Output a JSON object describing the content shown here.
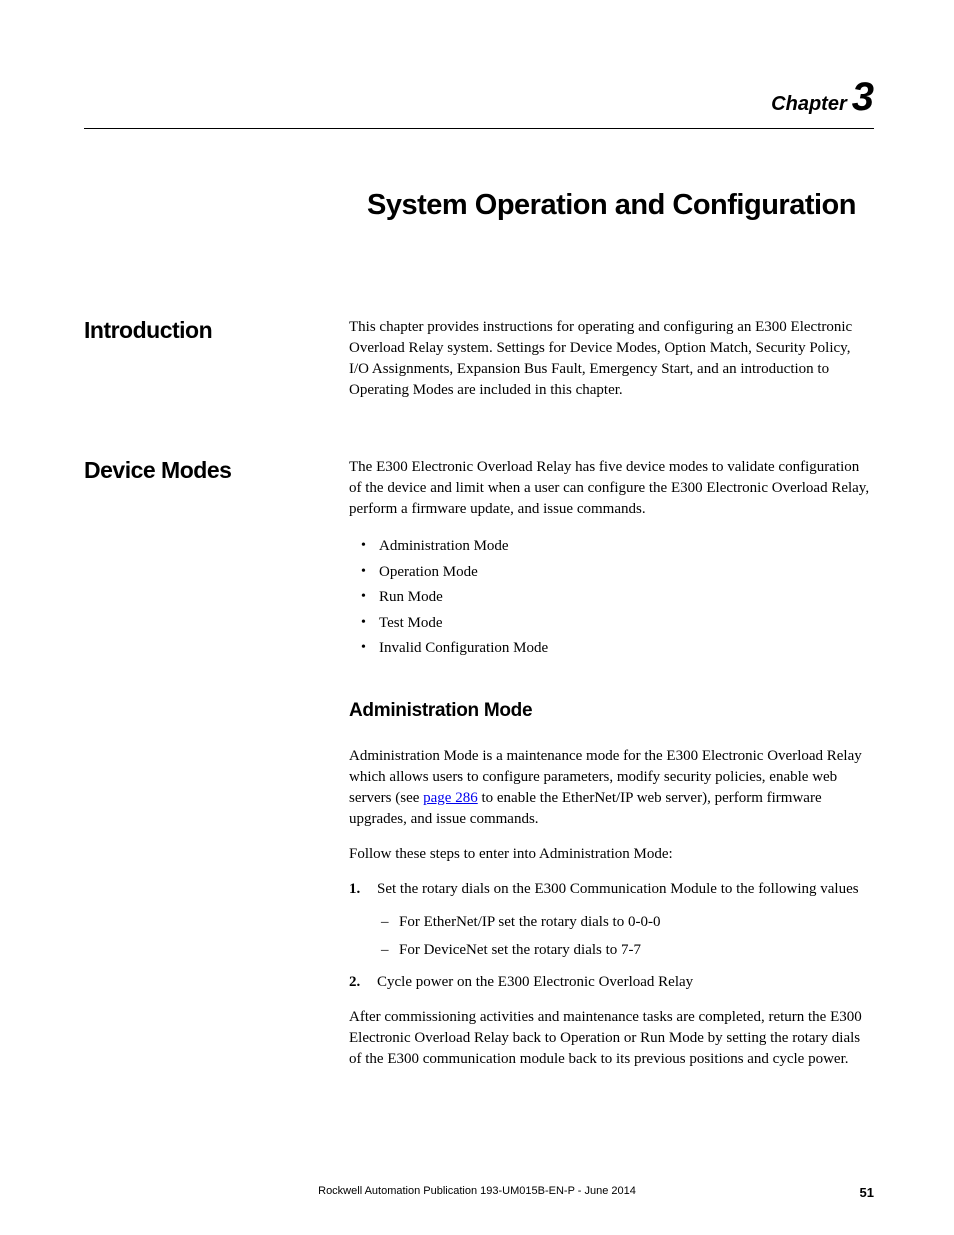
{
  "chapter": {
    "label": "Chapter",
    "number": "3"
  },
  "title": "System Operation and Configuration",
  "sections": {
    "introduction": {
      "heading": "Introduction",
      "body": "This chapter provides instructions for operating and configuring an E300 Electronic Overload Relay system. Settings for Device Modes, Option Match, Security Policy, I/O Assignments, Expansion Bus Fault, Emergency Start, and an introduction to Operating Modes are included in this chapter."
    },
    "deviceModes": {
      "heading": "Device Modes",
      "intro": "The E300 Electronic Overload Relay has five device modes to validate configuration of the device and limit when a user can configure the E300 Electronic Overload Relay, perform a firmware update, and issue commands.",
      "bullets": [
        "Administration Mode",
        "Operation Mode",
        "Run Mode",
        "Test Mode",
        "Invalid Configuration Mode"
      ],
      "adminMode": {
        "heading": "Administration Mode",
        "para1_before": "Administration Mode is a maintenance mode for the E300 Electronic Overload Relay which allows users to configure parameters, modify security policies, enable web servers (see ",
        "link": "page 286",
        "para1_after": " to enable the EtherNet/IP web server), perform firmware upgrades, and issue commands.",
        "para2": "Follow these steps to enter into Administration Mode:",
        "steps": [
          {
            "num": "1.",
            "text": "Set the rotary dials on the E300 Communication Module to the following values",
            "subs": [
              "For EtherNet/IP set the rotary dials to 0-0-0",
              "For DeviceNet set the rotary dials to 7-7"
            ]
          },
          {
            "num": "2.",
            "text": "Cycle power on the E300 Electronic Overload Relay",
            "subs": []
          }
        ],
        "para3": "After commissioning activities and maintenance tasks are completed, return the E300 Electronic Overload Relay back to Operation or Run Mode by setting the rotary dials of the E300 communication module back to its previous positions and cycle power."
      }
    }
  },
  "footer": {
    "text": "Rockwell Automation Publication 193-UM015B-EN-P - June 2014",
    "pageNumber": "51"
  }
}
